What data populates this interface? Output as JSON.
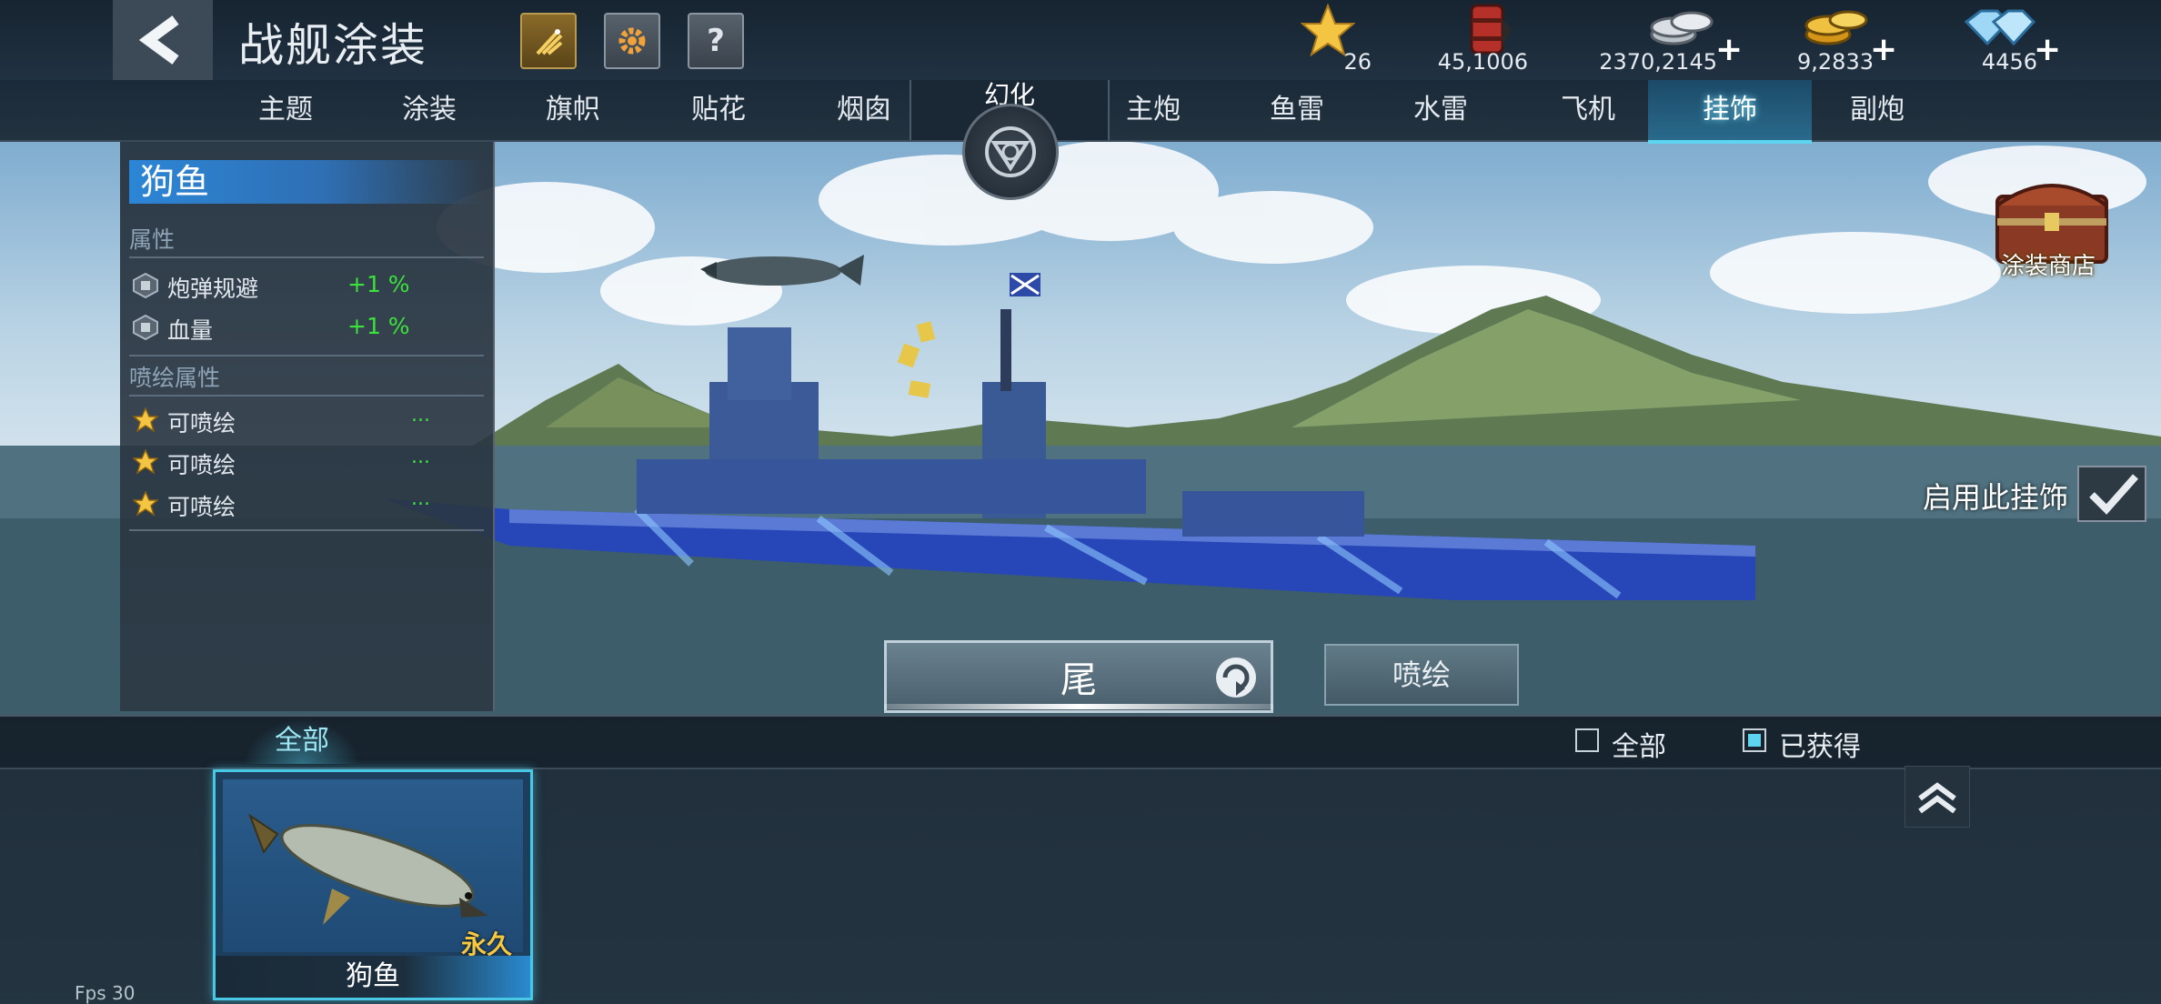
{
  "header": {
    "title": "战舰涂装",
    "currencies": [
      {
        "name": "star",
        "value": "26",
        "has_plus": false
      },
      {
        "name": "fuel-barrel",
        "value": "45,1006",
        "has_plus": false
      },
      {
        "name": "silver-coins",
        "value": "2370,2145",
        "has_plus": true
      },
      {
        "name": "gold-coins",
        "value": "9,2833",
        "has_plus": true
      },
      {
        "name": "diamonds",
        "value": "4456",
        "has_plus": true
      }
    ],
    "plus_label": "+"
  },
  "tabs": [
    {
      "label": "主题",
      "active": false
    },
    {
      "label": "涂装",
      "active": false
    },
    {
      "label": "旗帜",
      "active": false
    },
    {
      "label": "贴花",
      "active": false
    },
    {
      "label": "烟囱",
      "active": false
    },
    {
      "label": "主炮",
      "active": false
    },
    {
      "label": "鱼雷",
      "active": false
    },
    {
      "label": "水雷",
      "active": false
    },
    {
      "label": "飞机",
      "active": false
    },
    {
      "label": "挂饰",
      "active": true
    },
    {
      "label": "副炮",
      "active": false
    }
  ],
  "huanhua": {
    "label": "幻化"
  },
  "info": {
    "name": "狗鱼",
    "attr_section": "属性",
    "attributes": [
      {
        "label": "炮弹规避",
        "value": "+1 %"
      },
      {
        "label": "血量",
        "value": "+1 %"
      }
    ],
    "spray_section": "喷绘属性",
    "spray_slots": [
      {
        "label": "可喷绘",
        "value": "..."
      },
      {
        "label": "可喷绘",
        "value": "..."
      },
      {
        "label": "可喷绘",
        "value": "..."
      }
    ]
  },
  "shop": {
    "label": "涂装商店"
  },
  "enable": {
    "label": "启用此挂饰",
    "checked": true
  },
  "buttons": {
    "tail": "尾",
    "spray": "喷绘"
  },
  "filter": {
    "tab_all": "全部",
    "check_all": {
      "label": "全部",
      "checked": false
    },
    "check_owned": {
      "label": "已获得",
      "checked": true
    }
  },
  "items": [
    {
      "name": "狗鱼",
      "duration": "永久",
      "selected": true
    }
  ],
  "fps": "Fps 30",
  "colors": {
    "active_tab": "#5cd6f0",
    "green_value": "#3ce23c",
    "hull": "#2747b8",
    "perm_gold": "#f5c842"
  }
}
